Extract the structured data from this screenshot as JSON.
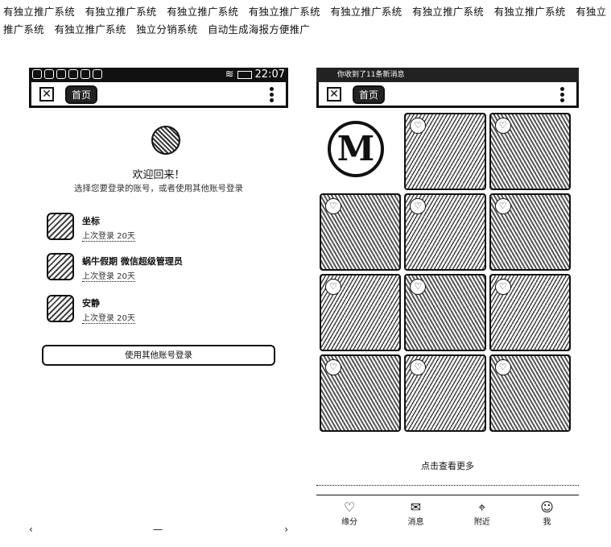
{
  "header_text": "有独立推广系统　有独立推广系统　有独立推广系统　有独立推广系统　有独立推广系统　有独立推广系统　有独立推广系统　有独立推广系统　有独立推广系统　独立分销系统　自动生成海报方便推广",
  "left_phone": {
    "status_time": "22:07",
    "title": "首页",
    "welcome": "欢迎回来！",
    "welcome_sub": "选择您要登录的账号，或者使用其他账号登录",
    "accounts": [
      {
        "name": "坐标",
        "meta": "上次登录 20天"
      },
      {
        "name": "蜗牛假期 微信超级管理员",
        "meta": "上次登录 20天"
      },
      {
        "name": "安静",
        "meta": "上次登录 20天"
      }
    ],
    "button": "使用其他账号登录",
    "nav": {
      "back": "‹",
      "home": "—",
      "recent": "›"
    }
  },
  "right_phone": {
    "status_text": "你收到了11条新消息",
    "title": "首页",
    "more_link": "点击查看更多",
    "tabs": [
      {
        "icon": "heart-icon",
        "glyph": "♡",
        "label": "缘分"
      },
      {
        "icon": "mail-icon",
        "glyph": "✉",
        "label": "消息"
      },
      {
        "icon": "location-icon",
        "glyph": "⌖",
        "label": "附近"
      },
      {
        "icon": "person-icon",
        "glyph": "☺",
        "label": "我"
      }
    ],
    "logo_letter": "M",
    "heart_glyph": "♡"
  }
}
